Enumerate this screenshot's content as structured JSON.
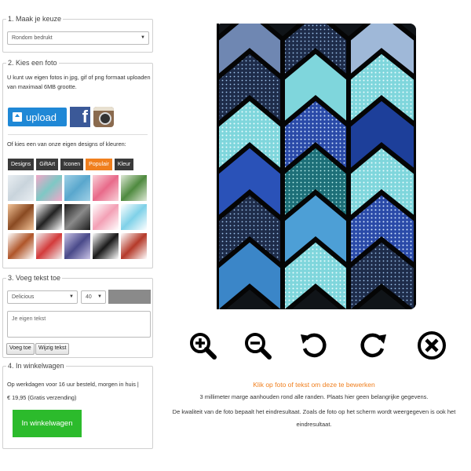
{
  "step1": {
    "legend": "1. Maak je keuze",
    "selected": "Rondom bedrukt"
  },
  "step2": {
    "legend": "2. Kies een foto",
    "instructions": "U kunt uw eigen fotos in jpg, gif of png formaat uploaden van maximaal 6MB grootte.",
    "upload_label": "upload",
    "facebook_label": "f",
    "designs_heading": "Of kies een van onze eigen designs of kleuren:",
    "tabs": [
      {
        "label": "Designs",
        "active": false
      },
      {
        "label": "GiftArt",
        "active": false
      },
      {
        "label": "Iconen",
        "active": false
      },
      {
        "label": "Populair",
        "active": true
      },
      {
        "label": "Kleur",
        "active": false
      }
    ],
    "thumbnails": [
      {
        "name": "marble-white",
        "colors": [
          "#e9eef2",
          "#c9d4dc"
        ]
      },
      {
        "name": "pineapple-pink",
        "colors": [
          "#f3a7c8",
          "#7ec8c5"
        ]
      },
      {
        "name": "blue-watercolor",
        "colors": [
          "#9fd0e6",
          "#5aa7cd"
        ]
      },
      {
        "name": "flamingo",
        "colors": [
          "#f9d2d9",
          "#e86a8a"
        ]
      },
      {
        "name": "tropical-leaves",
        "colors": [
          "#dfe9d6",
          "#4f8a3f"
        ]
      },
      {
        "name": "orange-leopard",
        "colors": [
          "#f3c59a",
          "#8a4a22"
        ]
      },
      {
        "name": "chevron-bw",
        "colors": [
          "#ffffff",
          "#222222"
        ]
      },
      {
        "name": "black-marble",
        "colors": [
          "#1b1b1b",
          "#8a8a8a"
        ]
      },
      {
        "name": "pink-heart",
        "colors": [
          "#ffffff",
          "#f3a0b5"
        ]
      },
      {
        "name": "blue-heart",
        "colors": [
          "#ffffff",
          "#7fd1e8"
        ]
      },
      {
        "name": "feathers",
        "colors": [
          "#ffffff",
          "#b0562a"
        ]
      },
      {
        "name": "rainbow-drip",
        "colors": [
          "#f0f0f0",
          "#d33b3b"
        ]
      },
      {
        "name": "geo-purple",
        "colors": [
          "#c9c3e6",
          "#4a4a8a"
        ]
      },
      {
        "name": "stripes-bw",
        "colors": [
          "#ffffff",
          "#1a1a1a"
        ]
      },
      {
        "name": "lips",
        "colors": [
          "#ffffff",
          "#b53a2a"
        ]
      }
    ]
  },
  "step3": {
    "legend": "3. Voeg tekst toe",
    "font": "Delicious",
    "size": "40",
    "color_hex": "#8a8a8a",
    "text_placeholder": "Je eigen tekst",
    "add_label": "Voeg toe",
    "edit_label": "Wijzig tekst"
  },
  "step4": {
    "legend": "4. In winkelwagen",
    "delivery": "Op werkdagen voor 16 uur besteld, morgen in huis |",
    "price": "€ 19,95 (Gratis verzending)",
    "cart_label": "In winkelwagen"
  },
  "controls": [
    "zoom-in",
    "zoom-out",
    "rotate-left",
    "rotate-right",
    "remove"
  ],
  "hints": {
    "click": "Klik op foto of tekst om deze te bewerken",
    "margin": "3 millimeter marge aanhouden rond alle randen. Plaats hier geen belangrijke gegevens.",
    "quality": "De kwaliteit van de foto bepaalt het eindresultaat. Zoals de foto op het scherm wordt weergegeven is ook het eindresultaat."
  },
  "colors": {
    "accent": "#f07f1e",
    "upload_blue": "#1f88d6",
    "cart_green": "#2cbb2c",
    "tab_dark": "#3a3a3a"
  }
}
